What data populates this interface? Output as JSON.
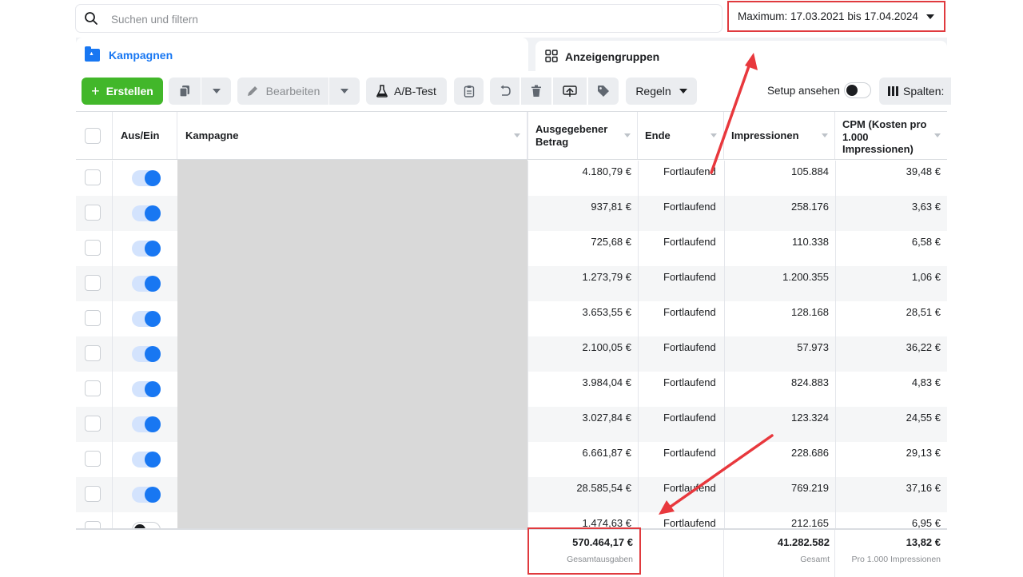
{
  "search": {
    "placeholder": "Suchen und filtern"
  },
  "date_range": {
    "label": "Maximum: 17.03.2021 bis 17.04.2024"
  },
  "tabs": [
    {
      "label": "Kampagnen",
      "active": true
    },
    {
      "label": "Anzeigengruppen",
      "active": false
    }
  ],
  "toolbar": {
    "create_label": "Erstellen",
    "edit_label": "Bearbeiten",
    "ab_test_label": "A/B-Test",
    "rules_label": "Regeln",
    "setup_label": "Setup ansehen",
    "columns_label": "Spalten:"
  },
  "columns": {
    "on_off": "Aus/Ein",
    "campaign": "Kampagne",
    "spent_line1": "Ausgegebener",
    "spent_line2": "Betrag",
    "end": "Ende",
    "impressions": "Impressionen",
    "cpm_line1": "CPM (Kosten pro",
    "cpm_line2": "1.000",
    "cpm_line3": "Impressionen)"
  },
  "rows": [
    {
      "spent": "4.180,79 €",
      "end": "Fortlaufend",
      "impressions": "105.884",
      "cpm": "39,48 €",
      "on": true
    },
    {
      "spent": "937,81 €",
      "end": "Fortlaufend",
      "impressions": "258.176",
      "cpm": "3,63 €",
      "on": true
    },
    {
      "spent": "725,68 €",
      "end": "Fortlaufend",
      "impressions": "110.338",
      "cpm": "6,58 €",
      "on": true
    },
    {
      "spent": "1.273,79 €",
      "end": "Fortlaufend",
      "impressions": "1.200.355",
      "cpm": "1,06 €",
      "on": true
    },
    {
      "spent": "3.653,55 €",
      "end": "Fortlaufend",
      "impressions": "128.168",
      "cpm": "28,51 €",
      "on": true
    },
    {
      "spent": "2.100,05 €",
      "end": "Fortlaufend",
      "impressions": "57.973",
      "cpm": "36,22 €",
      "on": true
    },
    {
      "spent": "3.984,04 €",
      "end": "Fortlaufend",
      "impressions": "824.883",
      "cpm": "4,83 €",
      "on": true
    },
    {
      "spent": "3.027,84 €",
      "end": "Fortlaufend",
      "impressions": "123.324",
      "cpm": "24,55 €",
      "on": true
    },
    {
      "spent": "6.661,87 €",
      "end": "Fortlaufend",
      "impressions": "228.686",
      "cpm": "29,13 €",
      "on": true
    },
    {
      "spent": "28.585,54 €",
      "end": "Fortlaufend",
      "impressions": "769.219",
      "cpm": "37,16 €",
      "on": true
    },
    {
      "spent": "1.474,63 €",
      "end": "Fortlaufend",
      "impressions": "212.165",
      "cpm": "6,95 €",
      "on": false
    }
  ],
  "totals": {
    "spent": "570.464,17 €",
    "spent_label": "Gesamtausgaben",
    "impressions": "41.282.582",
    "impressions_label": "Gesamt",
    "cpm": "13,82 €",
    "cpm_label": "Pro 1.000 Impressionen"
  },
  "colors": {
    "accent": "#1877f2",
    "create": "#42b72a",
    "highlight": "#e03a3e"
  }
}
